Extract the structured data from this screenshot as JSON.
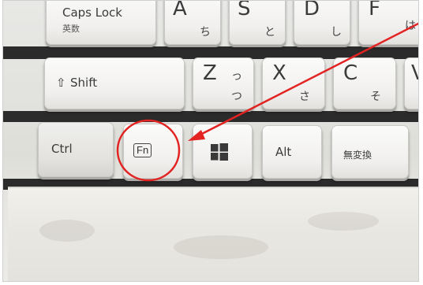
{
  "keys": {
    "caps_lock": {
      "label": "Caps Lock",
      "sub": "英数"
    },
    "a": {
      "label": "A",
      "kana": "ち"
    },
    "s": {
      "label": "S",
      "kana": "と"
    },
    "d": {
      "label": "D",
      "kana": "し"
    },
    "f": {
      "label": "F",
      "kana": "は"
    },
    "shift": {
      "icon": "shift-arrow-icon",
      "label": "Shift"
    },
    "z": {
      "label": "Z",
      "kana_top": "っ",
      "kana": "つ"
    },
    "x": {
      "label": "X",
      "kana": "さ"
    },
    "c": {
      "label": "C",
      "kana": "そ"
    },
    "v": {
      "label": "V"
    },
    "ctrl": {
      "label": "Ctrl"
    },
    "fn": {
      "label": "Fn"
    },
    "windows": {
      "icon": "windows-logo-icon"
    },
    "alt": {
      "label": "Alt"
    },
    "muhenkan": {
      "label": "無変換"
    }
  },
  "annotation": {
    "color": "#e32222",
    "circle_target": "Fn",
    "arrow_icon": "red-arrow-icon"
  }
}
